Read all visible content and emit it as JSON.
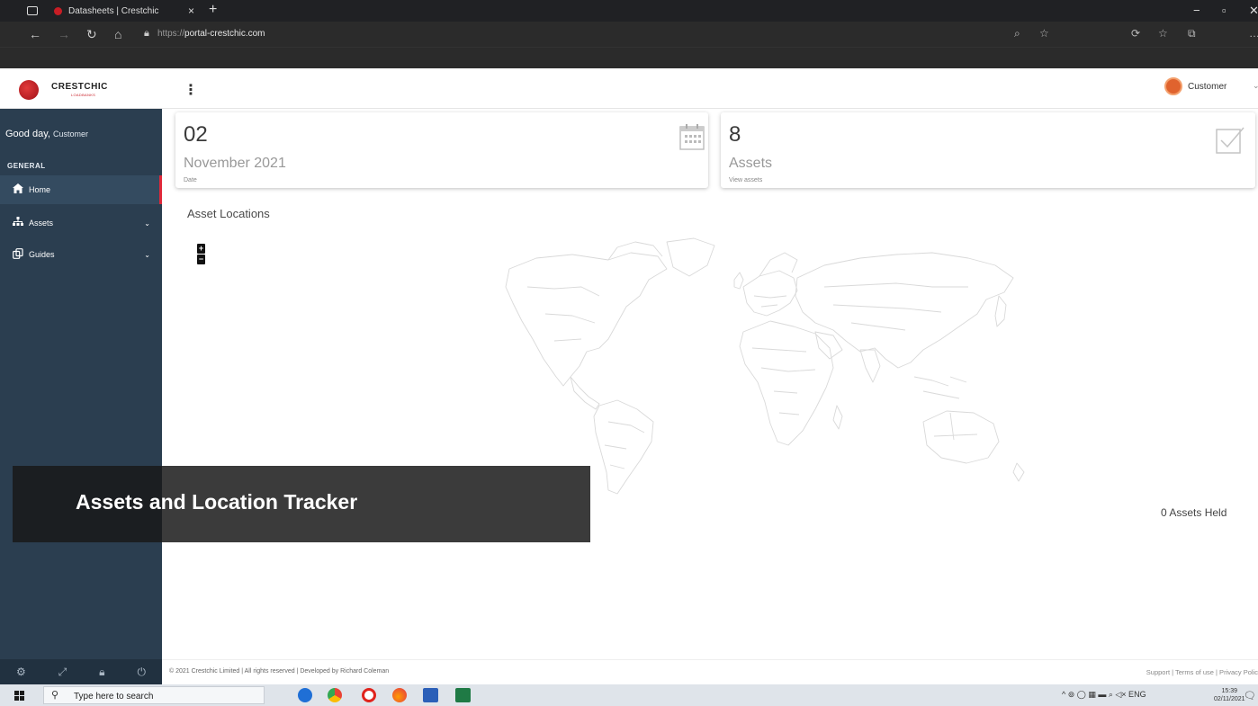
{
  "browser": {
    "tab_title": "Datasheets | Crestchic",
    "tab_close": "×",
    "new_tab": "+",
    "url_prefix": "https://",
    "url_host": "portal-crestchic.com"
  },
  "header": {
    "logo_text": "CRESTCHIC",
    "logo_sub": "LOADBANKS",
    "user_name": "Customer"
  },
  "sidebar": {
    "greeting": "Good day,",
    "greeting_name": "Customer",
    "section": "GENERAL",
    "items": [
      {
        "label": "Home",
        "icon": "home-icon",
        "glyph": "🏠"
      },
      {
        "label": "Assets",
        "icon": "sitemap-icon",
        "glyph": "⛬"
      },
      {
        "label": "Guides",
        "icon": "copy-icon",
        "glyph": "❐"
      }
    ]
  },
  "cards": {
    "date": {
      "big": "02",
      "mid": "November 2021",
      "small": "Date",
      "icon": "calendar-icon"
    },
    "assets": {
      "big": "8",
      "mid": "Assets",
      "small": "View assets",
      "icon": "checkbox-icon"
    }
  },
  "map": {
    "title": "Asset Locations",
    "zoom_in": "+",
    "zoom_out": "−",
    "assets_held": "0 Assets Held"
  },
  "footer": {
    "copyright": "© 2021 Crestchic Limited | All rights reserved | Developed by Richard Coleman",
    "links": "Support |  Terms of use |  Privacy Polic"
  },
  "overlay": {
    "caption": "Assets and Location Tracker"
  },
  "taskbar": {
    "search_placeholder": "Type here to search",
    "tray": "^ ⊚ ◯ ▦ ▬ ⌕ ◁× ENG",
    "time": "15:39",
    "date": "02/11/2021"
  },
  "colors": {
    "sidebar": "#2b3e50",
    "accent": "#e0283a",
    "brand_red": "#c81d25"
  }
}
